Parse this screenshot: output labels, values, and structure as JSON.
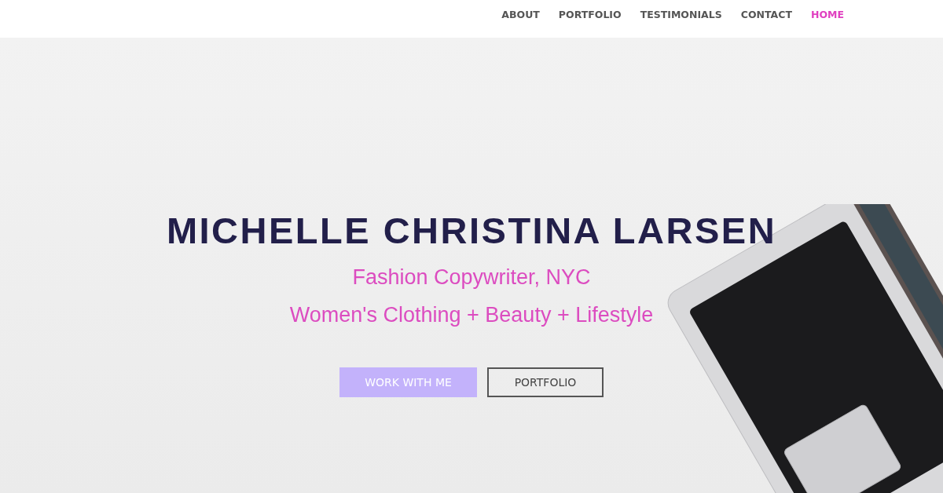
{
  "nav": [
    {
      "label": "ABOUT",
      "selected": false
    },
    {
      "label": "PORTFOLIO",
      "selected": false
    },
    {
      "label": "TESTIMONIALS",
      "selected": false
    },
    {
      "label": "CONTACT",
      "selected": false
    },
    {
      "label": "HOME",
      "selected": true
    }
  ],
  "hero": {
    "title": "MICHELLE CHRISTINA LARSEN",
    "subtitles": [
      "Fashion Copywriter, NYC",
      "Women's Clothing + Beauty + Lifestyle"
    ],
    "buttons": [
      {
        "label": "WORK WITH ME",
        "kind": "primary"
      },
      {
        "label": "PORTFOLIO",
        "kind": "outline"
      }
    ]
  }
}
